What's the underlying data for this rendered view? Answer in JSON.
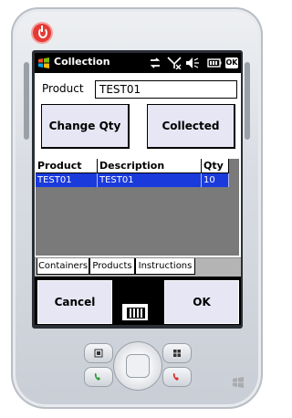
{
  "titlebar": {
    "title": "Collection",
    "ok_badge": "OK"
  },
  "form": {
    "product_label": "Product",
    "product_value": "TEST01"
  },
  "buttons": {
    "change_qty": "Change Qty",
    "collected": "Collected",
    "cancel": "Cancel",
    "ok": "OK"
  },
  "grid": {
    "columns": [
      "Product",
      "Description",
      "Qty"
    ],
    "rows": [
      {
        "product": "TEST01",
        "description": "TEST01",
        "qty": "10"
      }
    ]
  },
  "tabs": [
    "Containers",
    "Products",
    "Instructions"
  ],
  "colors": {
    "titlebar": "#000000",
    "selected_row": "#1a3adc",
    "button_face": "#e6e6f5",
    "device_body": "#d9dde3",
    "power": "#e53935"
  },
  "icons": [
    "windows-start-icon",
    "connectivity-icon",
    "signal-off-icon",
    "volume-icon",
    "battery-icon",
    "keyboard-icon",
    "power-icon",
    "call-icon",
    "end-call-icon",
    "windows-logo-icon"
  ]
}
